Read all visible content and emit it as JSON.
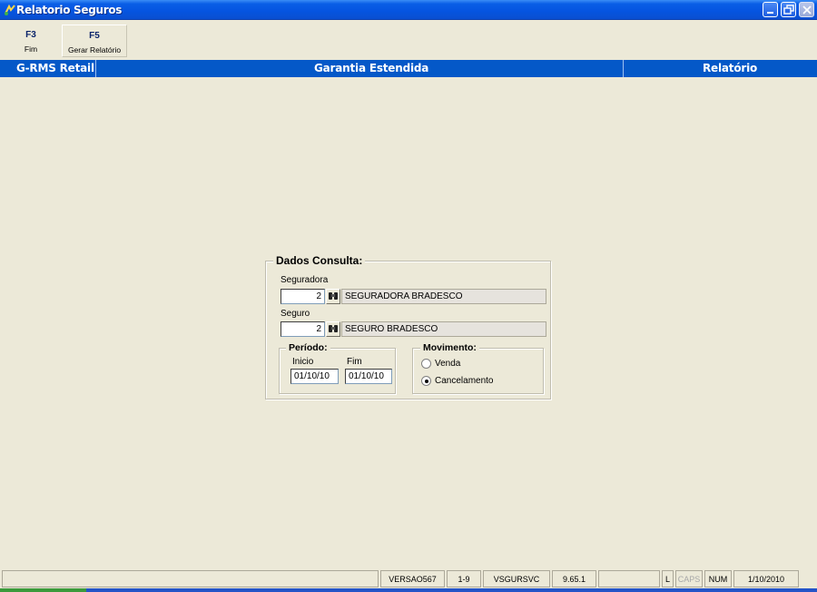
{
  "window": {
    "title": "Relatorio Seguros",
    "icon": "app-icon"
  },
  "toolbar": {
    "f3_key": "F3",
    "f3_label": "Fim",
    "f5_key": "F5",
    "f5_label": "Gerar Relatório"
  },
  "header": {
    "left": "G-RMS Retail",
    "center": "Garantia Estendida",
    "right": "Relatório"
  },
  "form": {
    "group_title": "Dados Consulta:",
    "seguradora": {
      "label": "Seguradora",
      "code": "2",
      "description": "SEGURADORA BRADESCO",
      "lookup_icon": "binoculars-icon"
    },
    "seguro": {
      "label": "Seguro",
      "code": "2",
      "description": "SEGURO BRADESCO",
      "lookup_icon": "binoculars-icon"
    },
    "periodo": {
      "title": "Período:",
      "inicio_label": "Inicio",
      "inicio_value": "01/10/10",
      "fim_label": "Fim",
      "fim_value": "01/10/10"
    },
    "movimento": {
      "title": "Movimento:",
      "options": [
        {
          "label": "Venda",
          "selected": false
        },
        {
          "label": "Cancelamento",
          "selected": true
        }
      ]
    }
  },
  "statusbar": {
    "cells": [
      "",
      "VERSAO567",
      "1-9",
      "VSGURSVC",
      "9.65.1",
      "",
      "L",
      "CAPS",
      "NUM",
      "1/10/2010"
    ]
  },
  "colors": {
    "header_band": "#0458c8",
    "window_bg": "#ece9d8"
  }
}
